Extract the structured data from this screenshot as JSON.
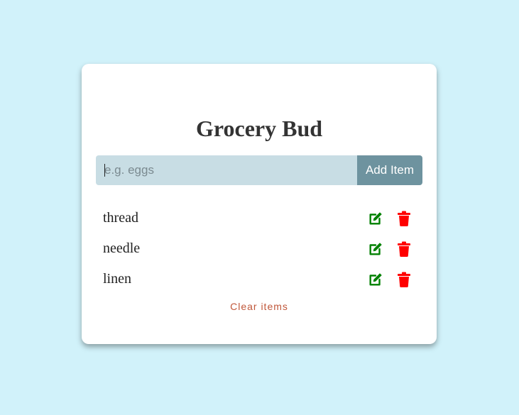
{
  "app": {
    "title": "Grocery Bud"
  },
  "form": {
    "placeholder": "e.g. eggs",
    "value": "",
    "add_label": "Add Item"
  },
  "items": [
    {
      "label": "thread"
    },
    {
      "label": "needle"
    },
    {
      "label": "linen"
    }
  ],
  "actions": {
    "clear_label": "Clear items"
  },
  "colors": {
    "background": "#d1f2fa",
    "card": "#ffffff",
    "input_bg": "#c8dde4",
    "button_bg": "#6e939f",
    "edit_icon": "#008000",
    "delete_icon": "#ff0000",
    "clear_text": "#c0573a"
  },
  "icons": {
    "edit": "edit-icon",
    "delete": "trash-icon"
  }
}
